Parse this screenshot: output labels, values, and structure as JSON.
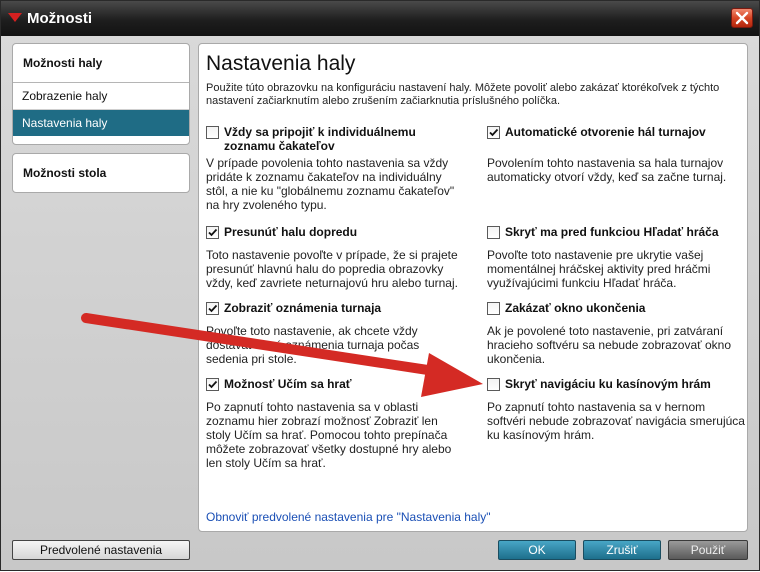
{
  "window": {
    "title": "Možnosti"
  },
  "sidebar": {
    "section1": {
      "title": "Možnosti haly",
      "items": [
        {
          "label": "Zobrazenie haly"
        },
        {
          "label": "Nastavenia haly"
        }
      ]
    },
    "section2": {
      "title": "Možnosti stola"
    }
  },
  "panel": {
    "title": "Nastavenia haly",
    "description": "Použite túto obrazovku na konfiguráciu nastavení haly. Môžete povoliť alebo zakázať ktorékoľvek z týchto nastavení začiarknutím alebo zrušením začiarknutia príslušného políčka.",
    "options": [
      {
        "label": "Vždy sa pripojiť k individuálnemu zoznamu čakateľov",
        "checked": false,
        "desc": "V prípade povolenia tohto nastavenia sa vždy pridáte k zoznamu čakateľov na individuálny stôl, a nie ku \"globálnemu zoznamu čakateľov\" na hry zvoleného typu."
      },
      {
        "label": "Automatické otvorenie hál turnajov",
        "checked": true,
        "desc": "Povolením tohto nastavenia sa hala turnajov automaticky otvorí vždy, keď sa začne turnaj."
      },
      {
        "label": "Presunúť halu dopredu",
        "checked": true,
        "desc": "Toto nastavenie povoľte v prípade, že si prajete presunúť hlavnú halu do popredia obrazovky vždy, keď zavriete neturnajovú hru alebo turnaj."
      },
      {
        "label": "Skryť ma pred funkciou Hľadať hráča",
        "checked": false,
        "desc": "Povoľte toto nastavenie pre ukrytie vašej momentálnej hráčskej aktivity pred hráčmi využívajúcimi funkciu Hľadať hráča."
      },
      {
        "label": "Zobraziť oznámenia turnaja",
        "checked": true,
        "desc": "Povoľte toto nastavenie, ak chcete vždy dostávať nové oznámenia turnaja počas sedenia pri stole."
      },
      {
        "label": "Zakázať okno ukončenia",
        "checked": false,
        "desc": "Ak je povolené toto nastavenie, pri zatváraní hracieho softvéru sa nebude zobrazovať okno ukončenia."
      },
      {
        "label": "Možnosť Učím sa hrať",
        "checked": true,
        "desc": "Po zapnutí tohto nastavenia sa v oblasti zoznamu hier zobrazí možnosť Zobraziť len stoly Učím sa hrať. Pomocou tohto prepínača môžete zobrazovať všetky dostupné hry alebo len stoly Učím sa hrať."
      },
      {
        "label": "Skryť navigáciu ku kasínovým hrám",
        "checked": false,
        "desc": "Po zapnutí tohto nastavenia sa v hernom softvéri nebude zobrazovať navigácia smerujúca ku kasínovým hrám."
      }
    ],
    "reset_link": "Obnoviť predvolené nastavenia pre \"Nastavenia haly\""
  },
  "buttons": {
    "defaults": "Predvolené nastavenia",
    "ok": "OK",
    "cancel": "Zrušiť",
    "apply": "Použiť"
  },
  "colors": {
    "accent": "#1f6c85",
    "arrow": "#d42a24",
    "link": "#1a4fb5"
  }
}
